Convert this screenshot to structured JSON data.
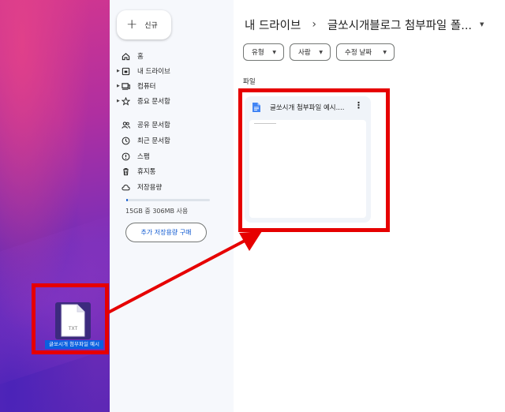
{
  "sidebar": {
    "new_label": "신규",
    "items": [
      {
        "label": "홈",
        "icon": "home-icon"
      },
      {
        "label": "내 드라이브",
        "icon": "drive-icon"
      },
      {
        "label": "컴퓨터",
        "icon": "computer-icon"
      },
      {
        "label": "중요 문서함",
        "icon": "star-icon"
      },
      {
        "label": "공유 문서함",
        "icon": "people-icon"
      },
      {
        "label": "최근 문서함",
        "icon": "clock-icon"
      },
      {
        "label": "스팸",
        "icon": "spam-icon"
      },
      {
        "label": "휴지통",
        "icon": "trash-icon"
      },
      {
        "label": "저장용량",
        "icon": "cloud-icon"
      }
    ],
    "storage_text": "15GB 중 306MB 사용",
    "storage_fraction": 0.02,
    "buy_label": "추가 저장용량 구매"
  },
  "main": {
    "breadcrumb_root": "내 드라이브",
    "breadcrumb_current": "글쏘시개블로그 첨부파일 폴...",
    "filters": [
      "유형",
      "사람",
      "수정 날짜"
    ],
    "section_label": "파일",
    "file": {
      "name": "글쏘시개 첨부파일 예시....",
      "icon": "google-docs-icon"
    }
  },
  "desktop": {
    "file_label": "글쏘시개 첨부파일 예시",
    "file_icon_text": "TXT",
    "file_icon": "txt-file-icon"
  },
  "colors": {
    "highlight": "#e60000",
    "accent": "#0b57d0",
    "docs_blue": "#4285f4"
  }
}
